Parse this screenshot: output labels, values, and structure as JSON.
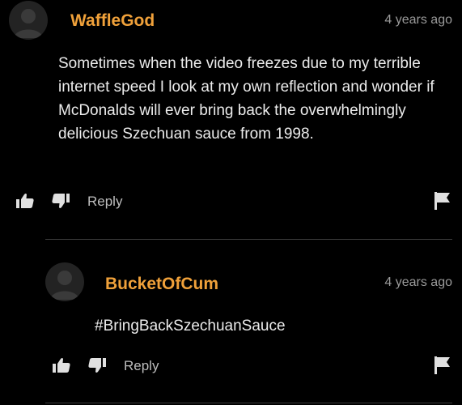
{
  "colors": {
    "background": "#000000",
    "username": "#f0a13a",
    "timestamp": "#9a9a9a",
    "body_text": "#ececec",
    "icon": "#e0e0e0",
    "divider": "#3a3a3a"
  },
  "comments": [
    {
      "username": "WaffleGod",
      "timestamp": "4 years ago",
      "text": "Sometimes when the video freezes due to my terrible internet speed I look at my own reflection and wonder if McDonalds will ever bring back the overwhelmingly delicious Szechuan sauce from 1998.",
      "reply_label": "Reply",
      "icons": [
        "avatar-icon",
        "thumbs-up-icon",
        "thumbs-down-icon",
        "flag-icon"
      ]
    },
    {
      "username": "BucketOfCum",
      "timestamp": "4 years ago",
      "text": "#BringBackSzechuanSauce",
      "reply_label": "Reply",
      "icons": [
        "avatar-icon",
        "thumbs-up-icon",
        "thumbs-down-icon",
        "flag-icon"
      ]
    }
  ]
}
